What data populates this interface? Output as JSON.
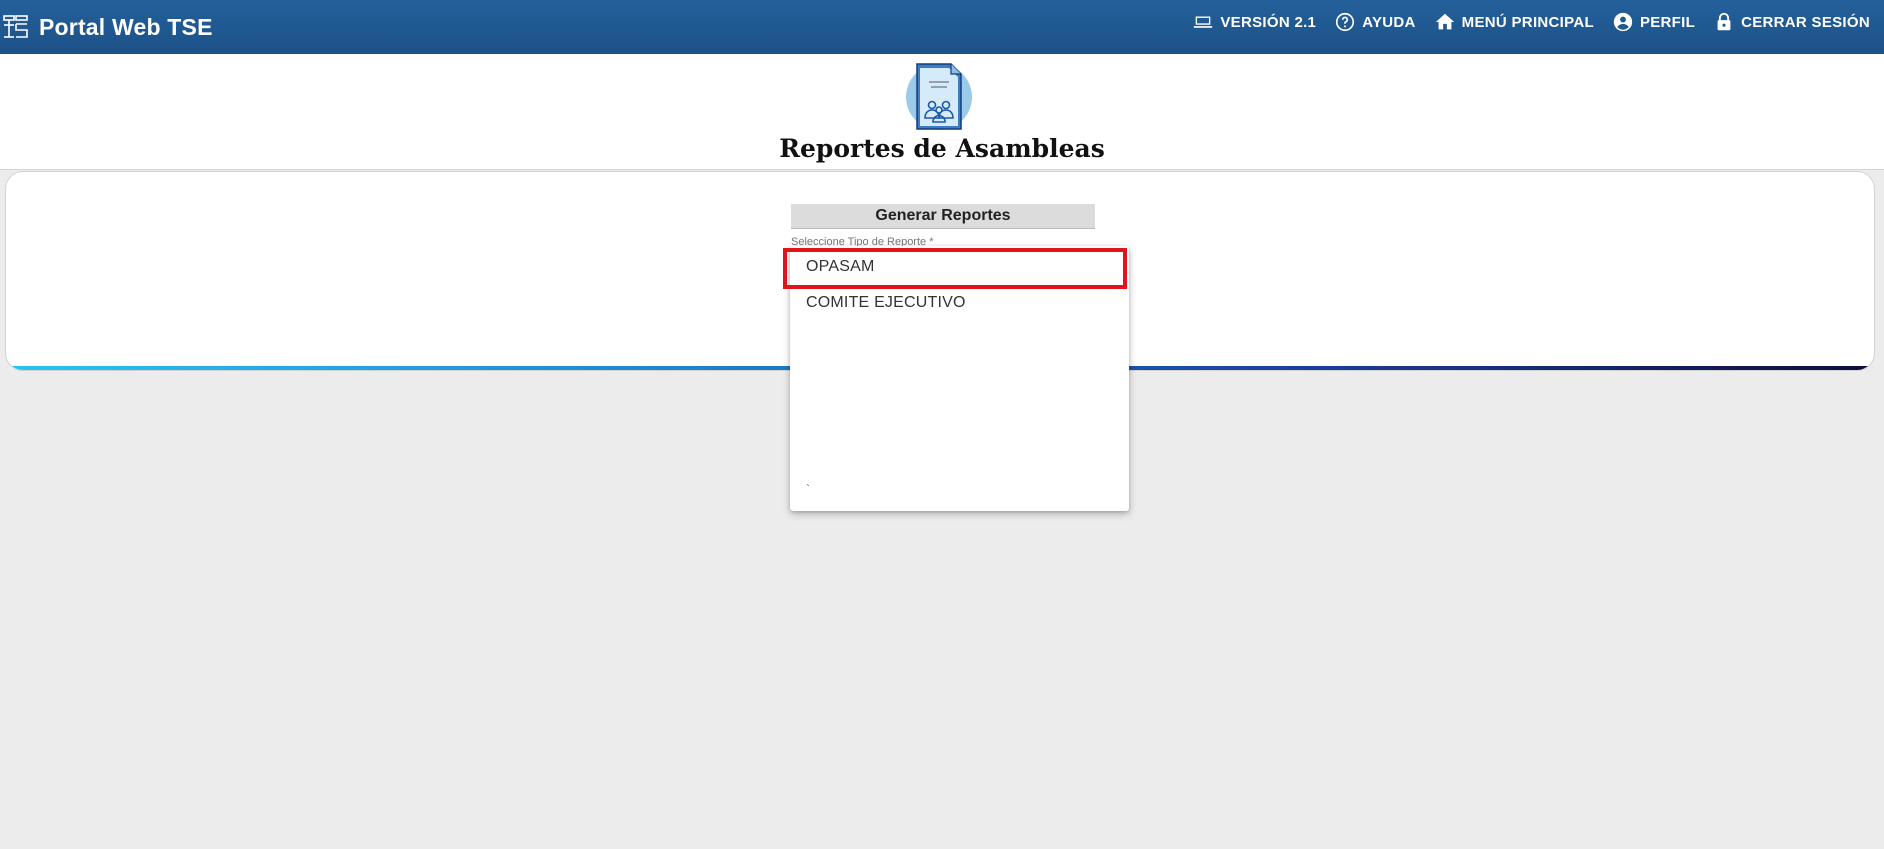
{
  "app": {
    "title": "Portal Web TSE"
  },
  "nav": {
    "items": [
      {
        "label": "VERSIÓN 2.1",
        "icon": "laptop-icon"
      },
      {
        "label": "AYUDA",
        "icon": "help-circle-icon"
      },
      {
        "label": "MENÚ PRINCIPAL",
        "icon": "home-icon"
      },
      {
        "label": "PERFIL",
        "icon": "account-circle-icon"
      },
      {
        "label": "CERRAR SESIÓN",
        "icon": "lock-icon"
      }
    ]
  },
  "page": {
    "icon": "report-document-icon",
    "title": "Reportes de Asambleas"
  },
  "form": {
    "section_title": "Generar Reportes",
    "field_label": "Seleccione Tipo de Reporte *"
  },
  "dropdown": {
    "options": [
      "OPASAM",
      "COMITE EJECUTIVO"
    ],
    "highlighted_option": "OPASAM",
    "stray_char": "`"
  },
  "colors": {
    "topbar": "#1f5a95",
    "highlight": "#e3131b",
    "accent_start": "#29c3f0",
    "accent_end": "#0d0d3b"
  }
}
